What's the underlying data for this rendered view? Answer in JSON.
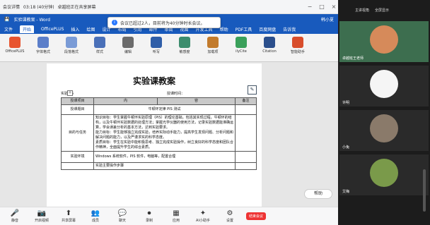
{
  "meeting_bar": {
    "app_title": "会议详情",
    "timer": "03:18 (40分钟)",
    "presenter": "卓越班正在共享屏幕"
  },
  "word": {
    "title": "实验课教案 - Word",
    "user": "韩小夏"
  },
  "notification": "会议已超过2人，目前将为40分钟时长会议。",
  "ribbon_tabs": [
    "文件",
    "开始",
    "OfficePLUS",
    "插入",
    "绘图",
    "设计",
    "布局",
    "引用",
    "邮件",
    "审阅",
    "视图",
    "开发工具",
    "帮助",
    "PDF工具",
    "百度网盘",
    "告诉我"
  ],
  "active_tab": "开始",
  "ribbon_buttons": [
    "OfficePLUS",
    "字体格式",
    "段落格式",
    "样式",
    "编辑",
    "听写",
    "敏感度",
    "加载项",
    "ilyCite",
    "Citation",
    "智能助手"
  ],
  "doc": {
    "title": "实验课教案",
    "meta": {
      "lab_label": "实验：5",
      "hours_label": "授课时间：",
      "teacher_label": ""
    },
    "header_row": {
      "c1": "授课项目",
      "c2": "内",
      "c3": "容",
      "c4": "备注"
    },
    "row_project": {
      "label": "授课题目",
      "content": "牛顿环定律 PIS 测试"
    },
    "row_goals": {
      "label": "目的与任务",
      "p1": "知识目标：学生掌握牛顿环实验原理（PIS）的理论基础，包括其实现过程，牛顿环的结构，以及牛顿环实验数据的处理方法；掌握光学仪器的使用方法，记录实验数据能准确运算，学会误差分析的基本方法，达到实验要求。",
      "p2": "能力目标：学生能够独立完成实验，培养实际动手能力，提高学生发现问题、分析问题和解决问题的能力，以及严谨求实的科学态度。",
      "p3": "素质目标：学生在实验中能积极思考、独立完成实验操作，树立良好的科学态度和团队合作精神，全面提升学生的综合素质。"
    },
    "row_env": {
      "label": "实验环境",
      "content": "Windows 系统软件，PIS 软件，电脑等，配置合理"
    },
    "row_next": {
      "label": "",
      "content": "实验主要操作步骤"
    }
  },
  "float_pill": "帮助",
  "toolbar": {
    "left": [
      "静音",
      "开启视频"
    ],
    "items": [
      "静音",
      "开启视频",
      "共享屏幕",
      "成员",
      "聊天",
      "录制",
      "应用",
      "AI小助手",
      "设置"
    ],
    "end_label": "结束会议"
  },
  "participants": {
    "header": [
      "主讲视角",
      "全屏显示"
    ],
    "names": [
      "卓越班王老师",
      "许明",
      "小兔",
      "艾梅"
    ]
  }
}
